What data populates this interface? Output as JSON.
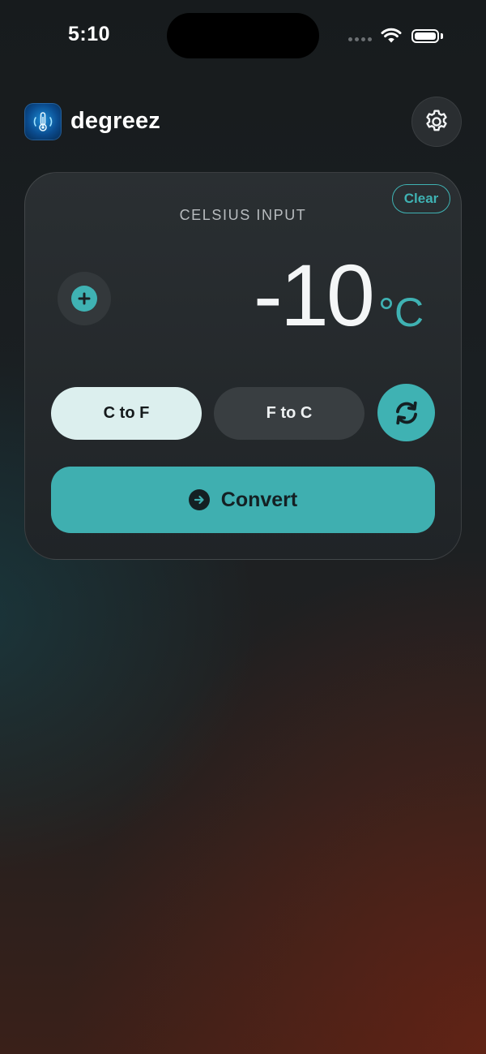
{
  "status_bar": {
    "time": "5:10"
  },
  "header": {
    "app_name": "degreez",
    "app_icon": "thermometer-icon",
    "settings_icon": "gear-icon"
  },
  "converter": {
    "clear_label": "Clear",
    "input_label": "CELSIUS INPUT",
    "value": "-10",
    "unit": "°C",
    "increment_icon": "plus-icon",
    "modes": [
      {
        "label": "C to F",
        "selected": true
      },
      {
        "label": "F to C",
        "selected": false
      }
    ],
    "swap_icon": "refresh-icon",
    "convert_label": "Convert",
    "convert_icon": "arrow-right-icon"
  },
  "colors": {
    "accent": "#3fb2b3",
    "card": "#25292c",
    "selected_toggle": "#dcefee",
    "unselected_toggle": "#393e41"
  }
}
